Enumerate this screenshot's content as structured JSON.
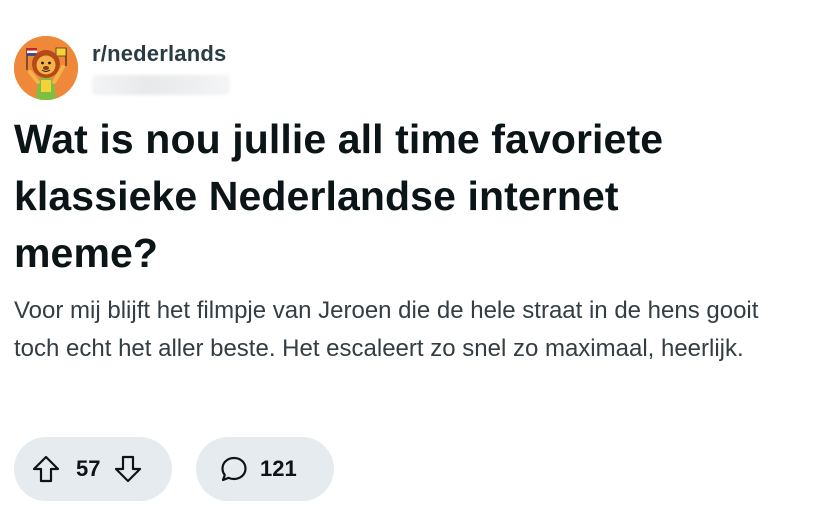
{
  "post": {
    "subreddit": "r/nederlands",
    "title": "Wat is nou jullie all time favoriete klassieke Nederlandse internet meme?",
    "body": "Voor mij blijft het filmpje van Jeroen die de hele straat in de hens gooit toch echt het aller beste. Het escaleert zo snel zo maximaal, heerlijk.",
    "upvotes": "57",
    "comments": "121"
  },
  "icons": {
    "avatar": "lion-mascot-avatar",
    "upvote": "arrow-up-icon",
    "downvote": "arrow-down-icon",
    "comment": "speech-bubble-icon"
  },
  "colors": {
    "avatar_bg": "#f0883a",
    "pill_bg": "#e5ebee",
    "title_text": "#0b1416",
    "body_text": "#333d42"
  }
}
